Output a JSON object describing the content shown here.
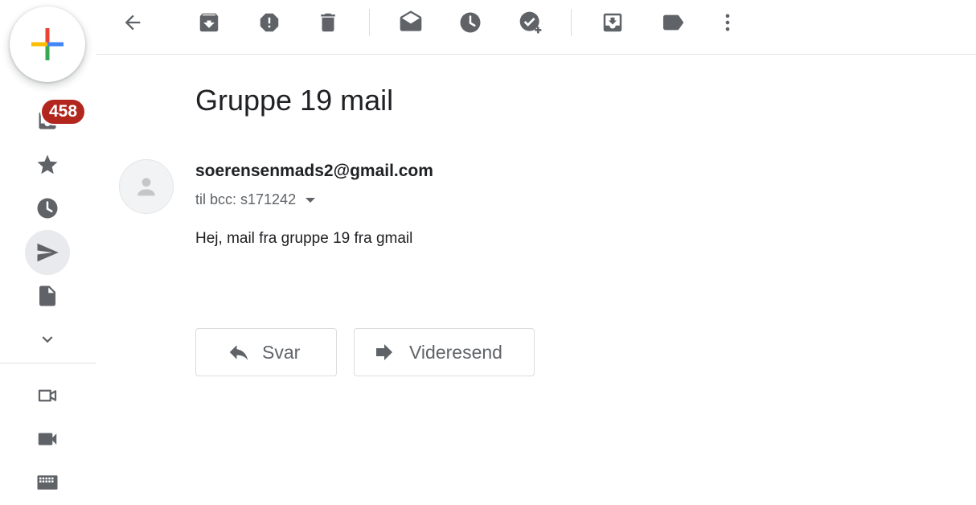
{
  "sidebar": {
    "compose_icon": "multicolor-plus-icon",
    "inbox_badge": "458",
    "items": [
      {
        "icon": "inbox-icon"
      },
      {
        "icon": "star-icon"
      },
      {
        "icon": "clock-icon"
      },
      {
        "icon": "send-icon"
      },
      {
        "icon": "draft-file-icon"
      },
      {
        "icon": "chevron-down-icon"
      },
      {
        "icon": "video-call-new-icon"
      },
      {
        "icon": "video-camera-icon"
      },
      {
        "icon": "keyboard-icon"
      }
    ]
  },
  "toolbar": {
    "icons": [
      "back-arrow-icon",
      "archive-icon",
      "report-spam-icon",
      "delete-icon",
      "mark-unread-icon",
      "snooze-icon",
      "add-task-icon",
      "move-to-icon",
      "label-icon",
      "more-vert-icon"
    ]
  },
  "message": {
    "subject": "Gruppe 19 mail",
    "sender": "soerensenmads2@gmail.com",
    "recipients": "til bcc: s171242",
    "body": "Hej, mail fra gruppe 19 fra gmail"
  },
  "actions": {
    "reply_label": "Svar",
    "forward_label": "Videresend"
  },
  "colors": {
    "badge": "#b3261e",
    "icon": "#5f6368",
    "border": "#dadce0"
  }
}
